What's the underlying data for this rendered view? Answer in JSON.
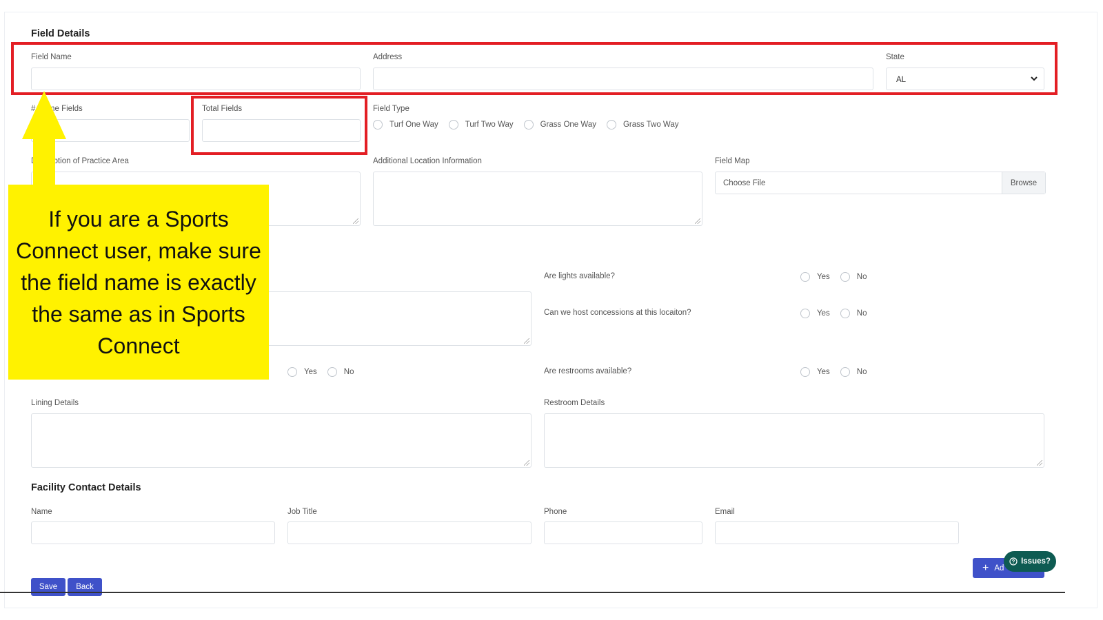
{
  "field_details": {
    "title": "Field Details",
    "field_name": {
      "label": "Field Name",
      "value": ""
    },
    "address": {
      "label": "Address",
      "value": ""
    },
    "state": {
      "label": "State",
      "value": "AL"
    },
    "game_fields": {
      "label": "# Game Fields",
      "value": ""
    },
    "total_fields": {
      "label": "Total Fields",
      "value": ""
    },
    "field_type": {
      "label": "Field Type",
      "options": [
        "Turf One Way",
        "Turf Two Way",
        "Grass One Way",
        "Grass Two Way"
      ]
    },
    "practice_area": {
      "label": "Description of Practice Area"
    },
    "additional_location": {
      "label": "Additional Location Information"
    },
    "field_map": {
      "label": "Field Map",
      "placeholder": "Choose File",
      "browse": "Browse"
    },
    "lights": {
      "question": "Are lights available?",
      "yes": "Yes",
      "no": "No"
    },
    "concessions": {
      "question": "Can we host concessions at this locaiton?",
      "yes": "Yes",
      "no": "No"
    },
    "lining": {
      "yes": "Yes",
      "no": "No"
    },
    "restrooms": {
      "question": "Are restrooms available?",
      "yes": "Yes",
      "no": "No"
    },
    "lining_details": {
      "label": "Lining Details"
    },
    "restroom_details": {
      "label": "Restroom Details"
    }
  },
  "contact": {
    "title": "Facility Contact Details",
    "name": "Name",
    "job_title": "Job Title",
    "phone": "Phone",
    "email": "Email"
  },
  "buttons": {
    "save": "Save",
    "back": "Back",
    "add": "Ad",
    "issues": "Issues?"
  },
  "callout": {
    "text": "If you are a Sports Connect user, make sure the field name is exactly the same as in Sports Connect"
  },
  "colors": {
    "annotation_red": "#e31e24",
    "callout_yellow": "#fff200",
    "primary_button": "#3f51c9",
    "issues_button": "#0e5b52"
  }
}
